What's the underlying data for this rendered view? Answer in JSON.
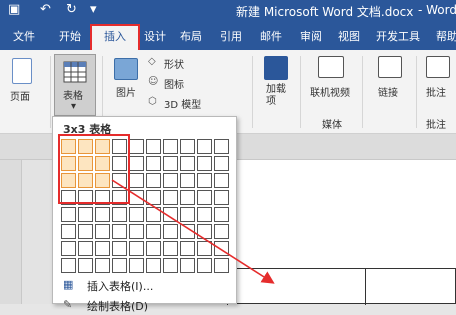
{
  "titlebar": {
    "title": "新建 Microsoft Word 文档.docx",
    "app_name": "- Word"
  },
  "tabs": [
    "文件",
    "开始",
    "插入",
    "设计",
    "布局",
    "引用",
    "邮件",
    "审阅",
    "视图",
    "开发工具",
    "帮助"
  ],
  "ribbon": {
    "page_label": "页面",
    "table_label": "表格",
    "picture_label": "图片",
    "shapes_label": "形状",
    "icons_label": "图标",
    "models_label": "3D 模型",
    "addins_label": "加载\n项",
    "online_video_label": "联机视频",
    "media_group": "媒体",
    "links_label": "链接",
    "comment_label": "批注",
    "comment_group": "批注"
  },
  "table_menu": {
    "title": "3x3 表格",
    "insert_table": "插入表格(I)...",
    "draw_table": "绘制表格(D)"
  },
  "colors": {
    "brand": "#2b579a",
    "highlight": "#e52c2c",
    "cell_selected": "#fde5c0"
  }
}
